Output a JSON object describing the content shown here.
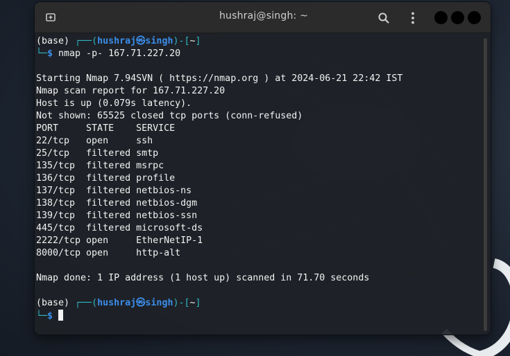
{
  "window": {
    "title": "hushraj@singh: ~"
  },
  "icons": {
    "new_tab": "new-tab-icon",
    "search": "search-icon",
    "menu": "kebab-menu-icon",
    "minimize": "minimize-button",
    "maximize": "maximize-button",
    "close": "close-button"
  },
  "colors": {
    "prompt_frame": "#2fb8c6",
    "prompt_user": "#3b8eea",
    "text": "#f2f2f2",
    "window_bg": "#1e2127",
    "titlebar_bg": "#2b2b2b"
  },
  "prompt1": {
    "env": "(base) ",
    "frame_open": "┌──(",
    "user": "hushraj",
    "at": "㉿",
    "host": "singh",
    "frame_close": ")-[",
    "dir": "~",
    "bracket_close": "]",
    "frame_bottom": "└─",
    "symbol": "$ ",
    "command": "nmap -p- 167.71.227.20"
  },
  "output": {
    "starting": "Starting Nmap 7.94SVN ( https://nmap.org ) at 2024-06-21 22:42 IST",
    "report": "Nmap scan report for 167.71.227.20",
    "host_up": "Host is up (0.079s latency).",
    "not_shown": "Not shown: 65525 closed tcp ports (conn-refused)",
    "header": "PORT     STATE    SERVICE",
    "ports": [
      "22/tcp   open     ssh",
      "25/tcp   filtered smtp",
      "135/tcp  filtered msrpc",
      "136/tcp  filtered profile",
      "137/tcp  filtered netbios-ns",
      "138/tcp  filtered netbios-dgm",
      "139/tcp  filtered netbios-ssn",
      "445/tcp  filtered microsoft-ds",
      "2222/tcp open     EtherNetIP-1",
      "8000/tcp open     http-alt"
    ],
    "done": "Nmap done: 1 IP address (1 host up) scanned in 71.70 seconds"
  },
  "prompt2": {
    "env": "(base) ",
    "frame_open": "┌──(",
    "user": "hushraj",
    "at": "㉿",
    "host": "singh",
    "frame_close": ")-[",
    "dir": "~",
    "bracket_close": "]",
    "frame_bottom": "└─",
    "symbol": "$ "
  }
}
